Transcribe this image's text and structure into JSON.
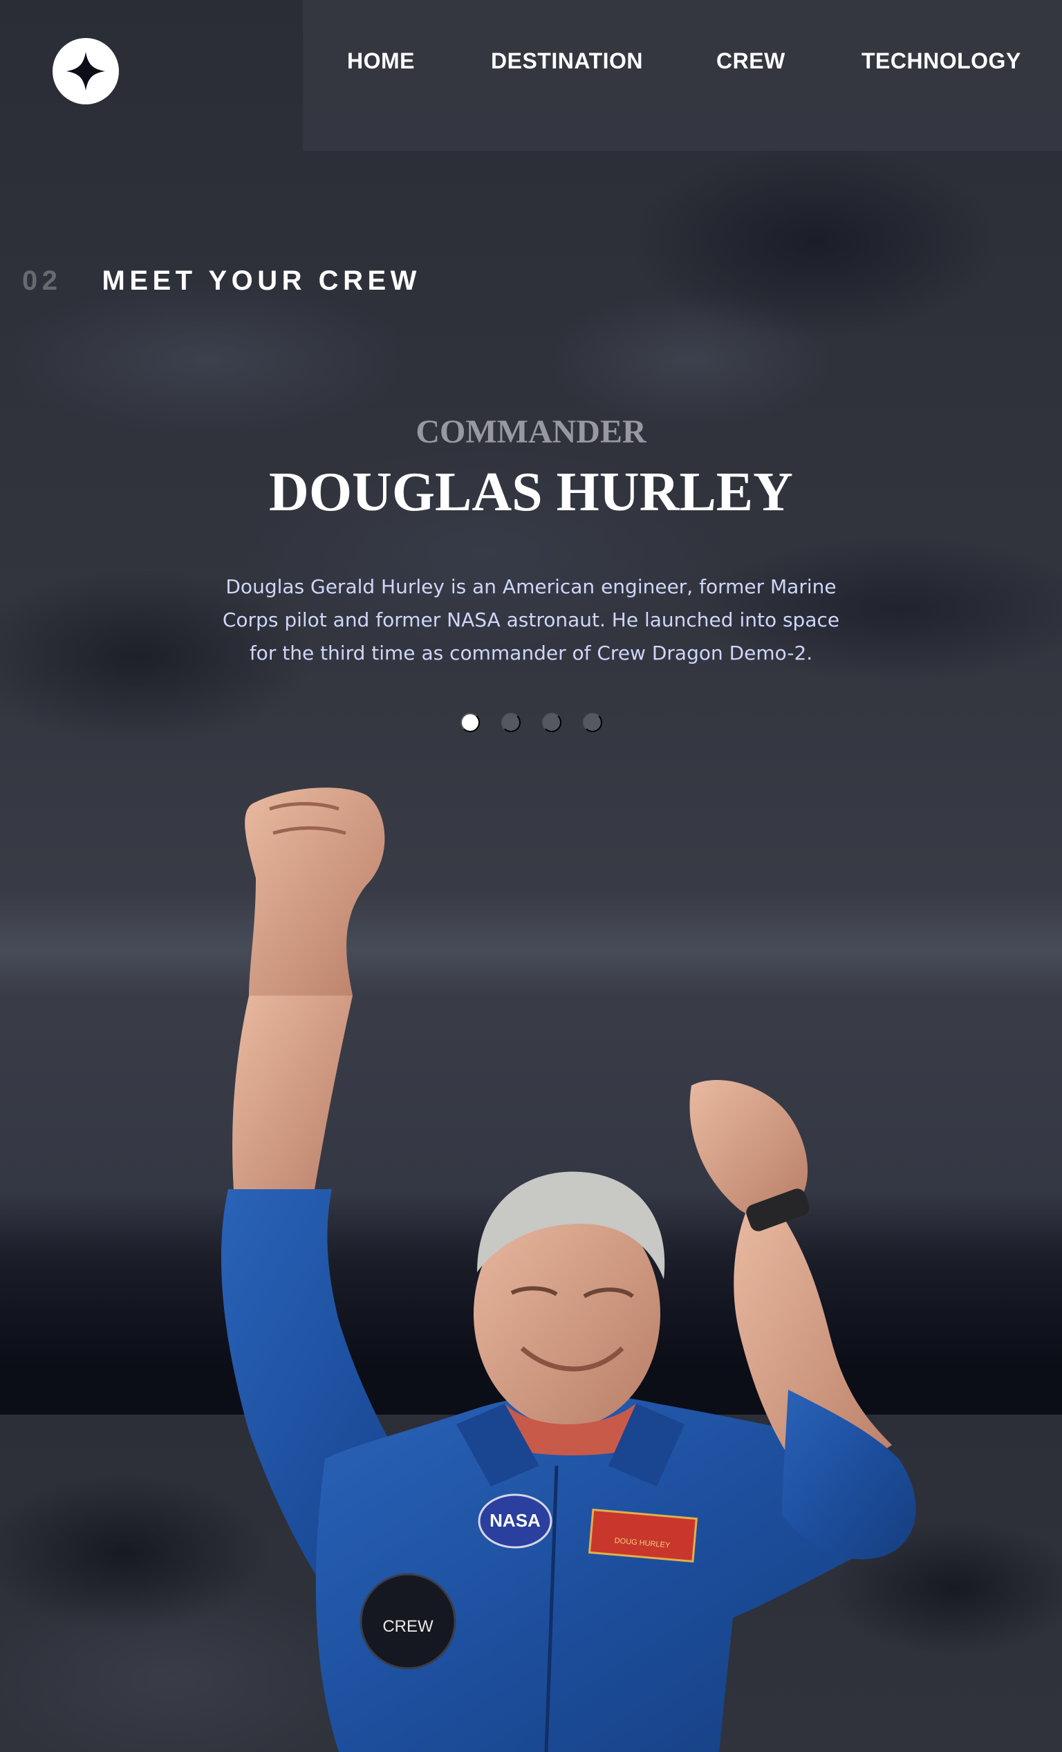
{
  "nav": {
    "items": [
      {
        "label": "HOME"
      },
      {
        "label": "DESTINATION"
      },
      {
        "label": "CREW"
      },
      {
        "label": "TECHNOLOGY"
      }
    ]
  },
  "page": {
    "number": "02",
    "title": "MEET YOUR CREW"
  },
  "crew": {
    "role": "COMMANDER",
    "name": "DOUGLAS HURLEY",
    "bio": "Douglas Gerald Hurley is an American engineer, former Marine Corps pilot and former NASA astronaut. He launched into space for the third time as commander of Crew Dragon Demo-2.",
    "slides_total": 4,
    "active_slide": 1
  },
  "image": {
    "badge_text": "NASA",
    "patch_text": "CREW",
    "nametag_text": "DOUG HURLEY"
  },
  "colors": {
    "background": "#0b0d17",
    "text": "#ffffff",
    "muted": "#d0d6f9",
    "suit": "#1d4f9e"
  }
}
